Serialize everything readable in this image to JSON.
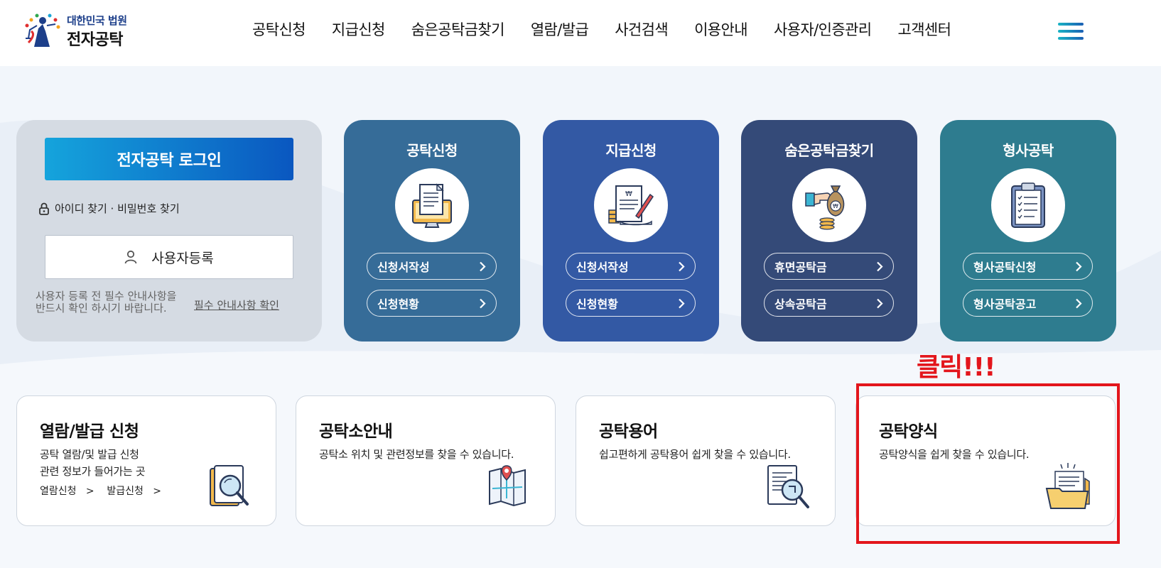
{
  "header": {
    "logo_sub": "대한민국 법원",
    "logo_main": "전자공탁",
    "nav": [
      "공탁신청",
      "지급신청",
      "숨은공탁금찾기",
      "열람/발급",
      "사건검색",
      "이용안내",
      "사용자/인증관리",
      "고객센터"
    ]
  },
  "login": {
    "login_button": "전자공탁 로그인",
    "find_link": "아이디 찾기 · 비밀번호 찾기",
    "register_button": "사용자등록",
    "notice_line1": "사용자 등록 전 필수 안내사항을",
    "notice_line2": "반드시 확인 하시기 바랍니다.",
    "notice_link": "필수 안내사항 확인"
  },
  "services": [
    {
      "title": "공탁신청",
      "icon": "monitor-document-icon",
      "color": "#366c98",
      "links": [
        "신청서작성",
        "신청현황"
      ]
    },
    {
      "title": "지급신청",
      "icon": "contract-pen-icon",
      "color": "#3359a4",
      "links": [
        "신청서작성",
        "신청현황"
      ]
    },
    {
      "title": "숨은공탁금찾기",
      "icon": "money-bag-hand-icon",
      "color": "#344a78",
      "links": [
        "휴면공탁금",
        "상속공탁금"
      ]
    },
    {
      "title": "형사공탁",
      "icon": "clipboard-checklist-icon",
      "color": "#2e7c8f",
      "links": [
        "형사공탁신청",
        "형사공탁공고"
      ]
    }
  ],
  "callout": "클릭!!!",
  "bottom_cards": [
    {
      "title": "열람/발급 신청",
      "desc1": "공탁 열람/및 발급 신청",
      "desc2": "관련 정보가 들어가는 곳",
      "link1": "열람신청",
      "link2": "발급신청",
      "icon": "document-search-icon"
    },
    {
      "title": "공탁소안내",
      "desc1": "공탁소 위치 및 관련정보를 찾을 수 있습니다.",
      "icon": "map-pin-icon"
    },
    {
      "title": "공탁용어",
      "desc1": "쉽고편하게 공탁용어 쉽게 찾을 수 있습니다.",
      "icon": "glossary-search-icon"
    },
    {
      "title": "공탁양식",
      "desc1": "공탁양식을 쉽게 찾을 수 있습니다.",
      "icon": "folder-forms-icon"
    }
  ]
}
